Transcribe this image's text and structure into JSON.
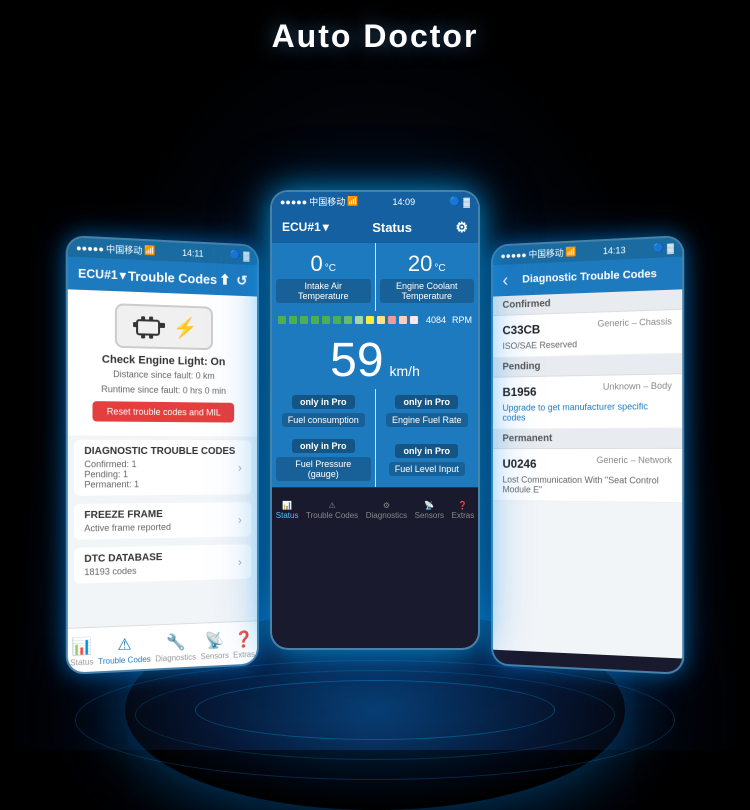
{
  "title": "Auto Doctor",
  "phones": {
    "left": {
      "statusBar": {
        "carrier": "中国移动",
        "time": "14:11",
        "icons": "● * ▶ ■"
      },
      "nav": {
        "ecu": "ECU#1",
        "title": "Trouble Codes",
        "icons": "⬆ ↺"
      },
      "engineIcon": "🔧",
      "checkEngineTitle": "Check Engine Light: On",
      "distanceFault": "Distance since fault: 0 km",
      "runtimeFault": "Runtime since fault: 0 hrs 0 min",
      "resetBtn": "Reset trouble codes and MIL",
      "sections": [
        {
          "label": "DIAGNOSTIC TROUBLE CODES",
          "sub": "Confirmed: 1\nPending: 1\nPermanent: 1"
        },
        {
          "label": "FREEZE FRAME",
          "sub": "Active frame reported"
        },
        {
          "label": "DTC DATABASE",
          "sub": "18193 codes"
        }
      ],
      "tabs": [
        "Status",
        "Trouble Codes",
        "Diagnostics",
        "Sensors",
        "Extras"
      ]
    },
    "center": {
      "statusBar": {
        "carrier": "中国移动",
        "time": "14:09",
        "icons": "● ▶ * ■"
      },
      "nav": {
        "ecu": "ECU#1",
        "title": "Status",
        "settingsIcon": "⚙"
      },
      "sensors": [
        {
          "value": "0",
          "unit": "°C",
          "label": "Intake Air\nTemperature"
        },
        {
          "value": "20",
          "unit": "°C",
          "label": "Engine Coolant\nTemperature"
        }
      ],
      "progressBarCount": 4084,
      "progressUnit": "RPM",
      "speed": "59",
      "speedUnit": "km/h",
      "proRows": [
        [
          {
            "badge": "only in Pro",
            "label": "Fuel consumption"
          },
          {
            "badge": "only in Pro",
            "label": "Engine Fuel Rate"
          }
        ],
        [
          {
            "badge": "only in Pro",
            "label": "Fuel Pressure\n(gauge)"
          },
          {
            "badge": "only in Pro",
            "label": "Fuel Level Input"
          }
        ]
      ],
      "tabs": [
        "Status",
        "Trouble Codes",
        "Diagnostics",
        "Sensors",
        "Extras"
      ]
    },
    "right": {
      "statusBar": {
        "carrier": "中国移动",
        "time": "14:13",
        "icons": "● ▶ * ■"
      },
      "nav": {
        "backIcon": "‹",
        "title": "Diagnostic Trouble Codes"
      },
      "sections": [
        {
          "header": "Confirmed",
          "codes": [
            {
              "code": "C33CB",
              "type": "Generic – Chassis",
              "desc": "ISO/SAE Reserved",
              "upgrade": ""
            }
          ]
        },
        {
          "header": "Pending",
          "codes": [
            {
              "code": "B1956",
              "type": "Unknown – Body",
              "desc": "Upgrade to get manufacturer specific codes",
              "upgrade": true
            }
          ]
        },
        {
          "header": "Permanent",
          "codes": [
            {
              "code": "U0246",
              "type": "Generic – Network",
              "desc": "Lost Communication With \"Seat Control Module E\"",
              "upgrade": ""
            }
          ]
        }
      ]
    }
  },
  "icons": {
    "status": "📊",
    "troubleCodes": "⚠",
    "diagnostics": "🔧",
    "sensors": "📡",
    "extras": "❓",
    "engine": "⚙",
    "lightning": "⚡",
    "chevron": "›",
    "back": "‹",
    "share": "⬆",
    "refresh": "↺",
    "settings": "⚙"
  }
}
